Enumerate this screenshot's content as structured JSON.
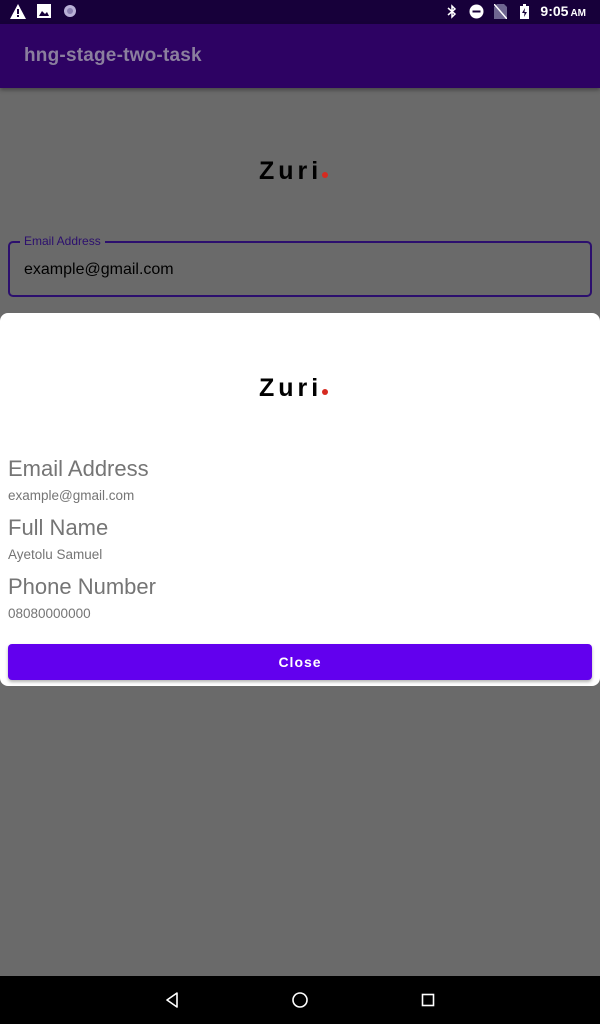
{
  "status_bar": {
    "time": "9:05",
    "am_pm": "AM",
    "left_icons": [
      "warning-icon",
      "image-icon",
      "circle-icon"
    ],
    "right_icons": [
      "bluetooth-icon",
      "do-not-disturb-icon",
      "no-sim-icon",
      "battery-charging-icon"
    ]
  },
  "app_bar": {
    "title": "hng-stage-two-task"
  },
  "background": {
    "logo_text": "Zuri",
    "email_field": {
      "label": "Email Address",
      "value": "example@gmail.com"
    }
  },
  "dialog": {
    "logo_text": "Zuri",
    "fields": [
      {
        "title": "Email Address",
        "value": "example@gmail.com"
      },
      {
        "title": "Full Name",
        "value": "Ayetolu Samuel"
      },
      {
        "title": "Phone Number",
        "value": "08080000000"
      }
    ],
    "close_label": "Close"
  },
  "nav_bar": {
    "buttons": [
      "back-icon",
      "home-icon",
      "recents-icon"
    ]
  },
  "colors": {
    "primary": "#6200ee",
    "status_bar": "#17003a",
    "app_bar": "#2d0263",
    "scrim": "#6a6a6a",
    "logo_dot": "#d62a20"
  }
}
